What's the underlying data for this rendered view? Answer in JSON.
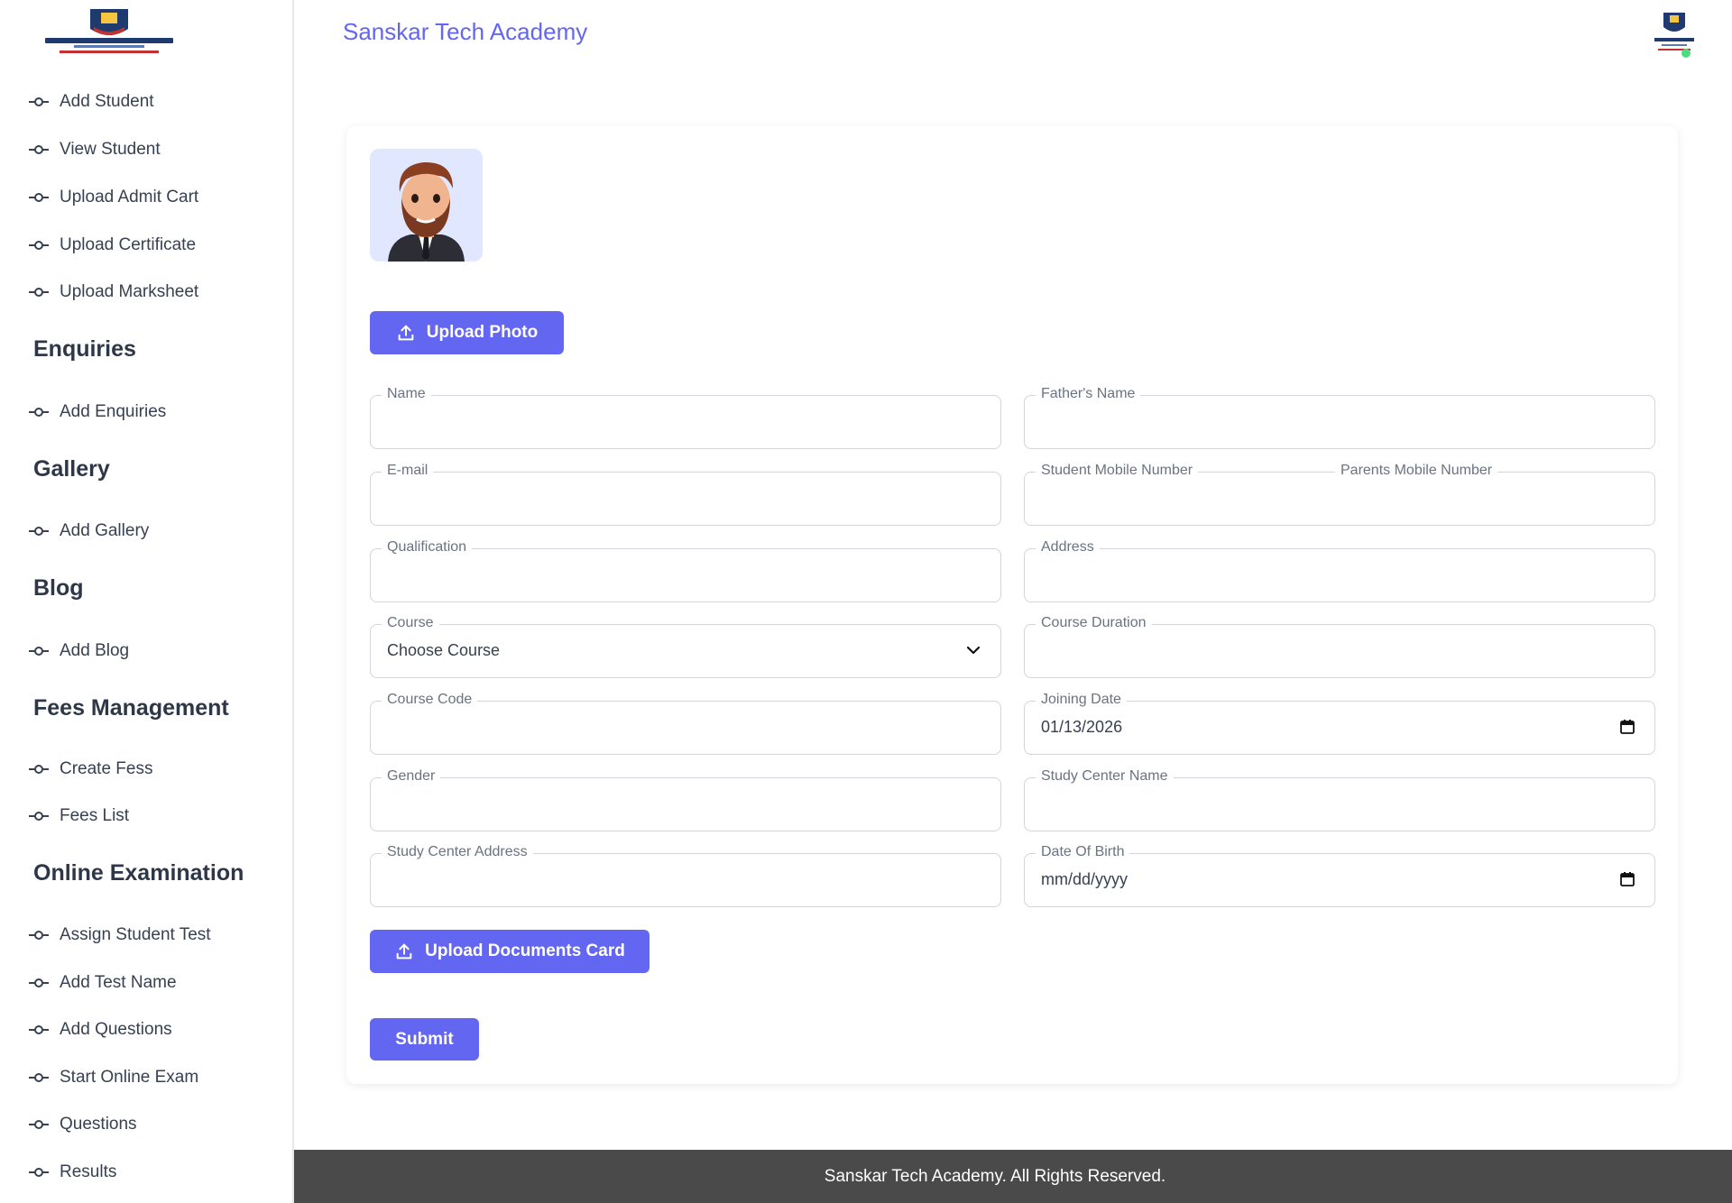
{
  "app": {
    "brand": "Sanskar Tech Academy"
  },
  "sidebar": {
    "logo_name": "sanskar-tech-academy-logo",
    "items_top": [
      {
        "label": "Add Student"
      },
      {
        "label": "View Student"
      },
      {
        "label": "Upload Admit Cart"
      },
      {
        "label": "Upload Certificate"
      },
      {
        "label": "Upload Marksheet"
      }
    ],
    "enquiries": {
      "heading": "Enquiries",
      "items": [
        {
          "label": "Add Enquiries"
        }
      ]
    },
    "gallery": {
      "heading": "Gallery",
      "items": [
        {
          "label": "Add Gallery"
        }
      ]
    },
    "blog": {
      "heading": "Blog",
      "items": [
        {
          "label": "Add Blog"
        }
      ]
    },
    "fees": {
      "heading": "Fees Management",
      "items": [
        {
          "label": "Create Fess"
        },
        {
          "label": "Fees List"
        }
      ]
    },
    "exam": {
      "heading": "Online Examination",
      "items": [
        {
          "label": "Assign Student Test"
        },
        {
          "label": "Add Test Name"
        },
        {
          "label": "Add Questions"
        },
        {
          "label": "Start Online Exam"
        },
        {
          "label": "Questions"
        },
        {
          "label": "Results"
        }
      ]
    }
  },
  "form": {
    "upload_photo": "Upload Photo",
    "upload_documents": "Upload Documents Card",
    "submit": "Submit",
    "fields": {
      "name": {
        "label": "Name",
        "value": ""
      },
      "fathers_name": {
        "label": "Father's Name",
        "value": ""
      },
      "email": {
        "label": "E-mail",
        "value": ""
      },
      "student_mobile": {
        "label": "Student Mobile Number",
        "value": ""
      },
      "parents_mobile": {
        "label": "Parents Mobile Number",
        "value": ""
      },
      "qualification": {
        "label": "Qualification",
        "value": ""
      },
      "address": {
        "label": "Address",
        "value": ""
      },
      "course": {
        "label": "Course",
        "value": "Choose Course"
      },
      "course_duration": {
        "label": "Course Duration",
        "value": ""
      },
      "course_code": {
        "label": "Course Code",
        "value": ""
      },
      "joining_date": {
        "label": "Joining Date",
        "value": "01/13/2026"
      },
      "gender": {
        "label": "Gender",
        "value": ""
      },
      "study_center_name": {
        "label": "Study Center Name",
        "value": ""
      },
      "study_center_address": {
        "label": "Study Center Address",
        "value": ""
      },
      "dob": {
        "label": "Date Of Birth",
        "value": "mm/dd/yyyy"
      }
    }
  },
  "footer": {
    "text": "Sanskar Tech Academy. All Rights Reserved."
  },
  "colors": {
    "accent": "#6366f1",
    "footer_bg": "#4a4a4a",
    "online": "#4ade80"
  }
}
